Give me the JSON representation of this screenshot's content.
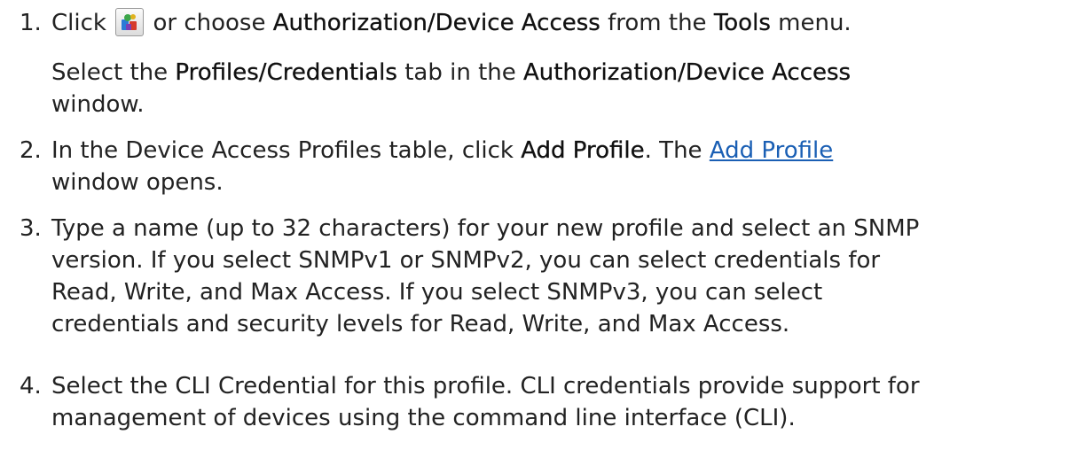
{
  "steps": [
    {
      "number": "1.",
      "line1": {
        "prefix": "Click ",
        "icon": "authorization-device-access-icon",
        "middle": " or choose ",
        "bold1": "Authorization/Device Access",
        "text2": " from the ",
        "bold2": "Tools",
        "text3": " menu."
      },
      "line2": {
        "prefix": "Select the ",
        "bold1": "Profiles/Credentials",
        "text2": " tab in the ",
        "bold2": "Authorization/Device Access"
      },
      "line3": "window."
    },
    {
      "number": "2.",
      "line1": {
        "prefix": "In the Device Access Profiles table, click ",
        "bold": "Add Profile",
        "text2": ". The ",
        "link": "Add Profile"
      },
      "line2": "window opens."
    },
    {
      "number": "3.",
      "lines": [
        "Type a name (up to 32 characters) for your new profile and select an SNMP",
        "version. If you select SNMPv1 or SNMPv2, you can select credentials for",
        "Read, Write, and Max Access. If you select SNMPv3, you can select",
        "credentials and security levels for Read, Write, and Max Access."
      ]
    },
    {
      "number": "4.",
      "lines": [
        "Select the CLI Credential for this profile. CLI credentials provide support for",
        "management of devices using the command line interface (CLI)."
      ]
    }
  ]
}
